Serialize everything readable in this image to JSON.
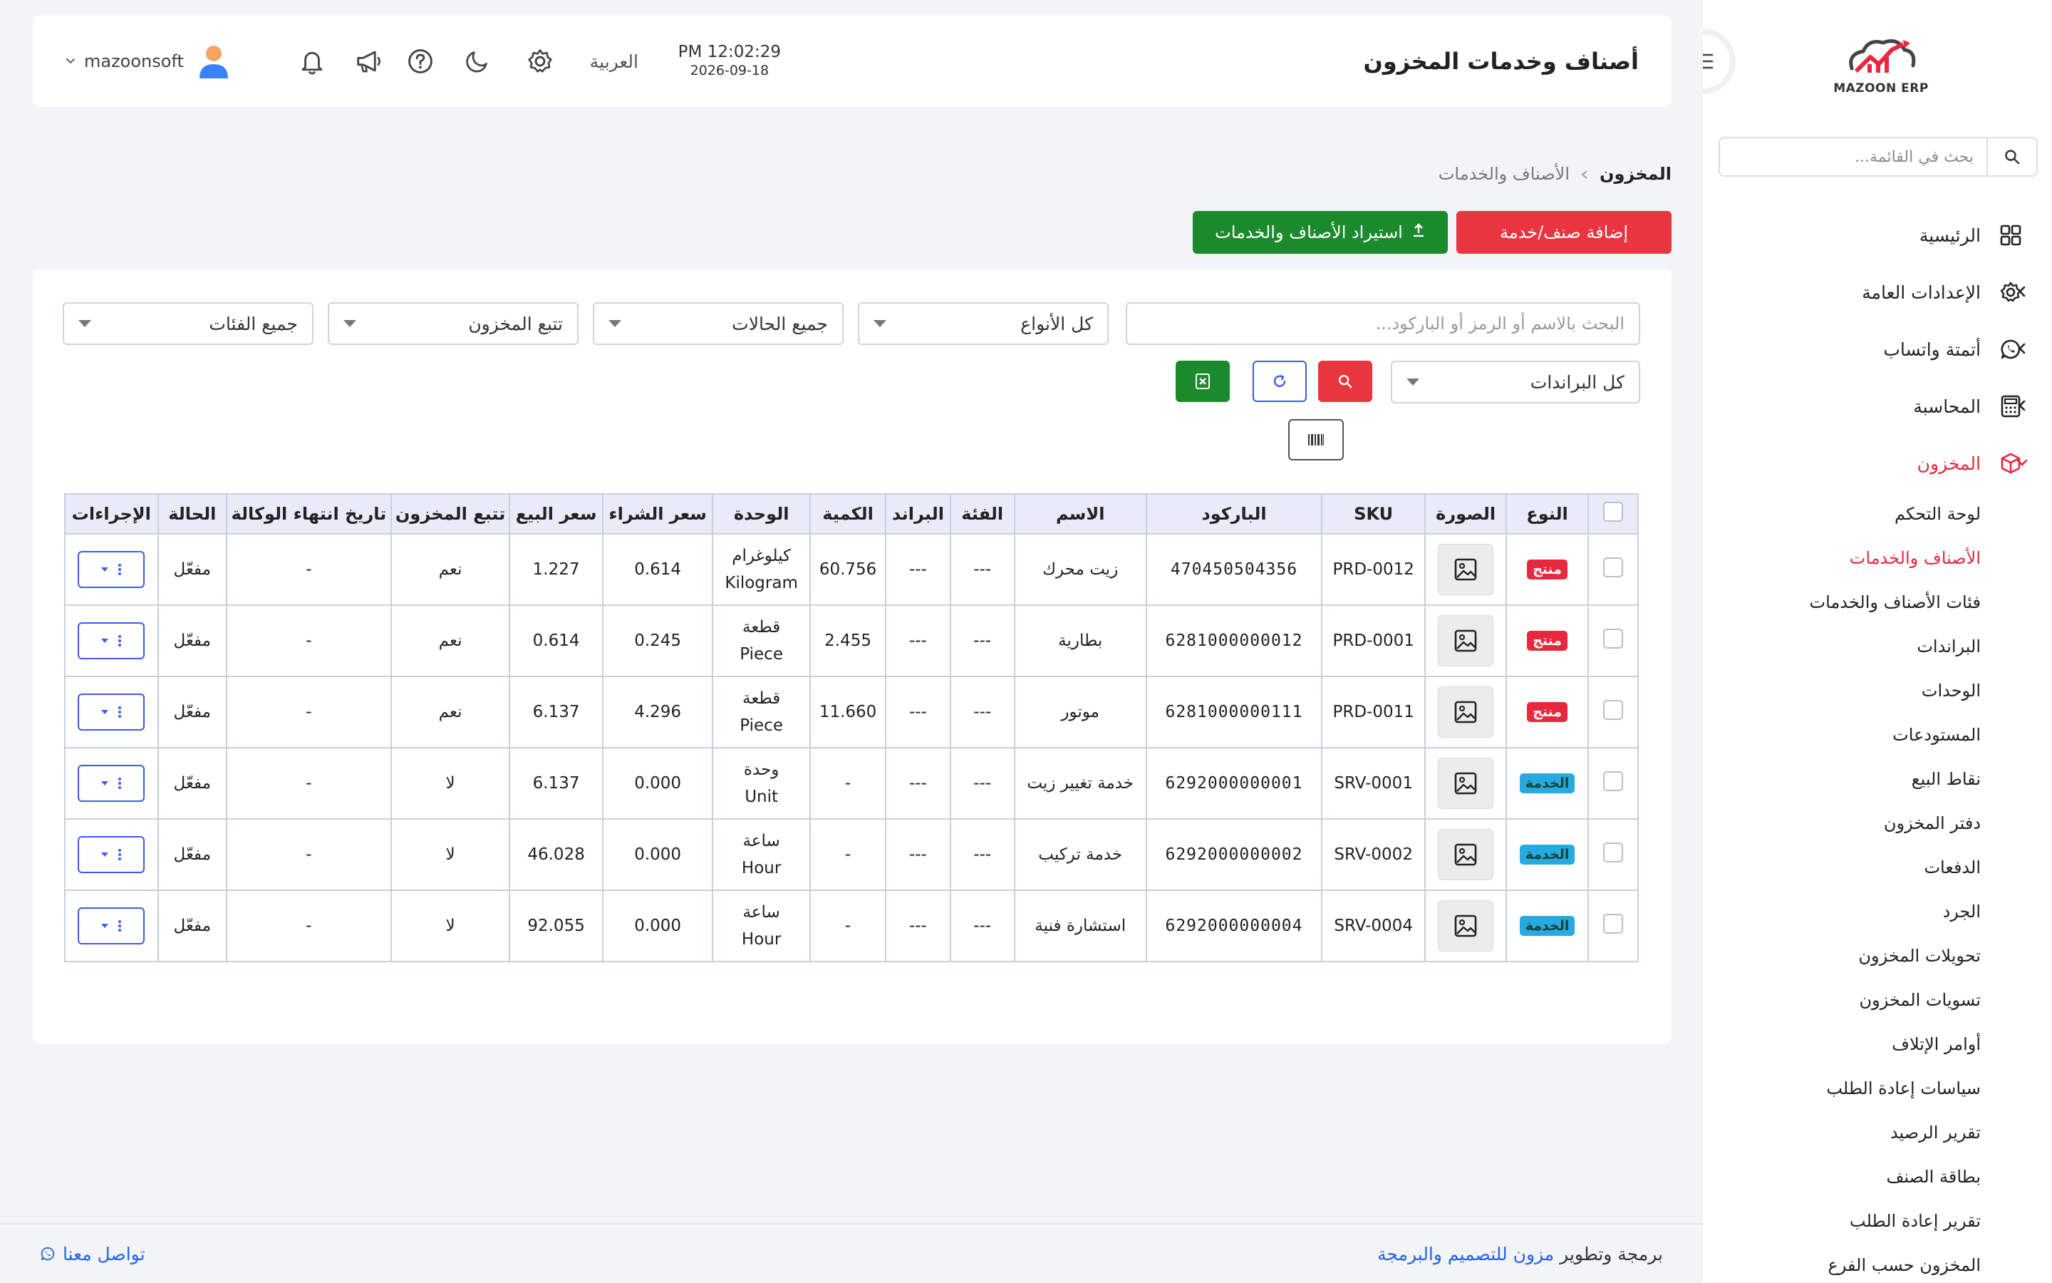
{
  "app": {
    "logo_text": "MAZOON ERP",
    "logo_small": "ERPERP"
  },
  "header": {
    "title": "أصناف وخدمات المخزون",
    "time": "PM 12:02:29",
    "date": "2026-09-18",
    "language": "العربية",
    "username": "mazoonsoft"
  },
  "sidebar": {
    "search_placeholder": "بحث في القائمة...",
    "items": [
      {
        "label": "الرئيسية",
        "icon": "grid-icon"
      },
      {
        "label": "الإعدادات العامة",
        "icon": "gear-icon"
      },
      {
        "label": "أتمتة واتساب",
        "icon": "whatsapp-icon"
      },
      {
        "label": "المحاسبة",
        "icon": "calculator-icon"
      },
      {
        "label": "المخزون",
        "icon": "box-icon"
      }
    ],
    "subitems": [
      "لوحة التحكم",
      "الأصناف والخدمات",
      "فئات الأصناف والخدمات",
      "البراندات",
      "الوحدات",
      "المستودعات",
      "نقاط البيع",
      "دفتر المخزون",
      "الدفعات",
      "الجرد",
      "تحويلات المخزون",
      "تسويات المخزون",
      "أوامر الإتلاف",
      "سياسات إعادة الطلب",
      "تقرير الرصيد",
      "بطاقة الصنف",
      "تقرير إعادة الطلب",
      "المخزون حسب الفرع"
    ]
  },
  "breadcrumb": {
    "root": "المخزون",
    "current": "الأصناف والخدمات"
  },
  "actions": {
    "add": "إضافة صنف/خدمة",
    "import": "استيراد الأصناف والخدمات"
  },
  "filters": {
    "search_placeholder": "البحث بالاسم أو الرمز أو الباركود...",
    "type": "كل الأنواع",
    "status": "جميع الحالات",
    "tracking": "تتبع المخزون",
    "category": "جميع الفئات",
    "brand": "كل البراندات"
  },
  "table": {
    "headers": [
      "النوع",
      "الصورة",
      "SKU",
      "الباركود",
      "الاسم",
      "الفئة",
      "البراند",
      "الكمية",
      "الوحدة",
      "سعر الشراء",
      "سعر البيع",
      "تتبع المخزون",
      "تاريخ انتهاء الوكالة",
      "الحالة",
      "الإجراءات"
    ],
    "rows": [
      {
        "type": "منتج",
        "kind": "product",
        "sku": "PRD-0012",
        "barcode": "470450504356",
        "name": "زيت محرك",
        "category": "---",
        "brand": "---",
        "qty": "60.756",
        "unit_ar": "كيلوغرام",
        "unit_en": "Kilogram",
        "buy": "0.614",
        "sell": "1.227",
        "track": "نعم",
        "expiry": "-",
        "status": "مفعّل"
      },
      {
        "type": "منتج",
        "kind": "product",
        "sku": "PRD-0001",
        "barcode": "6281000000012",
        "name": "بطارية",
        "category": "---",
        "brand": "---",
        "qty": "2.455",
        "unit_ar": "قطعة",
        "unit_en": "Piece",
        "buy": "0.245",
        "sell": "0.614",
        "track": "نعم",
        "expiry": "-",
        "status": "مفعّل"
      },
      {
        "type": "منتج",
        "kind": "product",
        "sku": "PRD-0011",
        "barcode": "6281000000111",
        "name": "موتور",
        "category": "---",
        "brand": "---",
        "qty": "11.660",
        "unit_ar": "قطعة",
        "unit_en": "Piece",
        "buy": "4.296",
        "sell": "6.137",
        "track": "نعم",
        "expiry": "-",
        "status": "مفعّل"
      },
      {
        "type": "الخدمة",
        "kind": "service",
        "sku": "SRV-0001",
        "barcode": "6292000000001",
        "name": "خدمة تغيير زيت",
        "category": "---",
        "brand": "---",
        "qty": "-",
        "unit_ar": "وحدة",
        "unit_en": "Unit",
        "buy": "0.000",
        "sell": "6.137",
        "track": "لا",
        "expiry": "-",
        "status": "مفعّل"
      },
      {
        "type": "الخدمة",
        "kind": "service",
        "sku": "SRV-0002",
        "barcode": "6292000000002",
        "name": "خدمة تركيب",
        "category": "---",
        "brand": "---",
        "qty": "-",
        "unit_ar": "ساعة",
        "unit_en": "Hour",
        "buy": "0.000",
        "sell": "46.028",
        "track": "لا",
        "expiry": "-",
        "status": "مفعّل"
      },
      {
        "type": "الخدمة",
        "kind": "service",
        "sku": "SRV-0004",
        "barcode": "6292000000004",
        "name": "استشارة فنية",
        "category": "---",
        "brand": "---",
        "qty": "-",
        "unit_ar": "ساعة",
        "unit_en": "Hour",
        "buy": "0.000",
        "sell": "92.055",
        "track": "لا",
        "expiry": "-",
        "status": "مفعّل"
      }
    ]
  },
  "footer": {
    "credit_prefix": "برمجة وتطوير",
    "credit_link": "مزون للتصميم والبرمجة",
    "contact": "تواصل معنا"
  },
  "colors": {
    "accent_red": "#e8353f",
    "accent_green": "#1b8a2c",
    "accent_blue": "#3d5af1",
    "badge_service": "#27a9e1"
  }
}
